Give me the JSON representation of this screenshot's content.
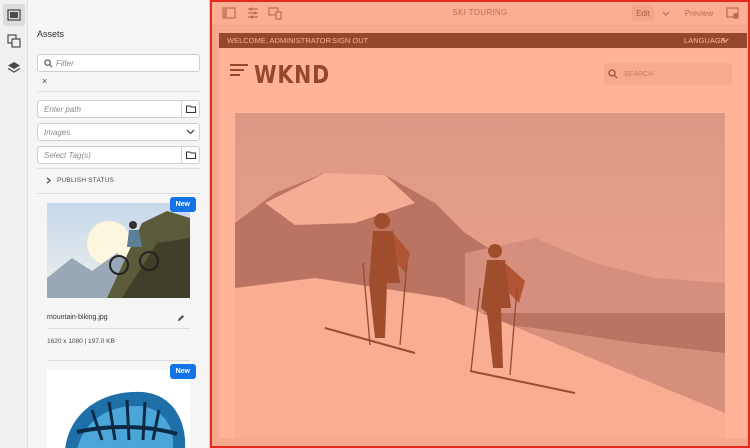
{
  "assets_panel": {
    "title": "Assets",
    "filter_placeholder": "Filter",
    "clear_label": "×",
    "path_placeholder": "Enter path",
    "type_selected": "Images",
    "tags_placeholder": "Select Tag(s)",
    "publish_status_label": "PUBLISH STATUS",
    "assets": [
      {
        "badge": "New",
        "filename": "mountain-biking.jpg",
        "info": "1620 x 1080 | 197.0 KB"
      },
      {
        "badge": "New"
      }
    ]
  },
  "editor": {
    "page_title": "SKI TOURING",
    "edit_label": "Edit",
    "preview_label": "Preview"
  },
  "site": {
    "welcome": "WELCOME, ADMINISTRATOR",
    "sign_out": "SIGN OUT",
    "language": "LANGUAGE",
    "logo": "WKND",
    "search_placeholder": "SEARCH"
  },
  "colors": {
    "overlay": "#ff6e3c",
    "overlay_border": "#e52a1d",
    "badge": "#1473e6"
  }
}
